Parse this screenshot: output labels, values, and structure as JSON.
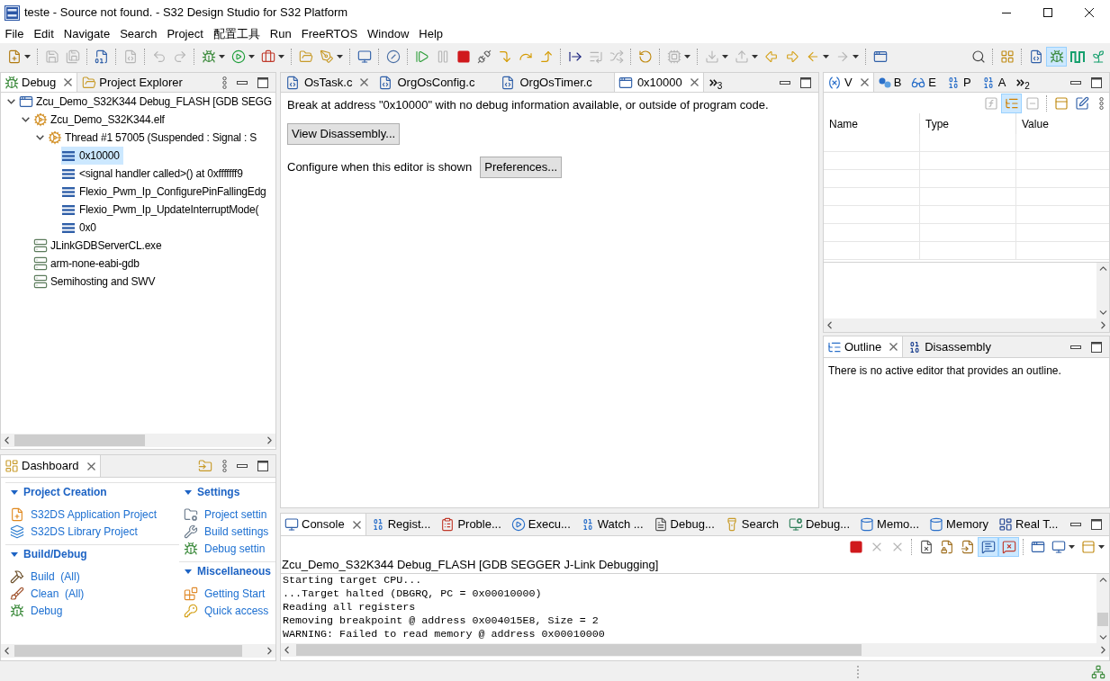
{
  "window": {
    "title": "teste - Source not found. - S32 Design Studio for S32 Platform"
  },
  "menu": [
    "File",
    "Edit",
    "Navigate",
    "Search",
    "Project",
    "配置工具",
    "Run",
    "FreeRTOS",
    "Window",
    "Help"
  ],
  "toolbar": [
    {
      "disabled": false
    },
    {
      "disabled": true
    },
    {
      "disabled": true
    },
    {
      "disabled": false
    },
    {
      "disabled": true
    },
    {
      "disabled": true
    },
    {
      "disabled": true
    },
    {
      "disabled": false
    },
    {
      "disabled": false
    },
    {
      "disabled": false
    },
    {
      "disabled": false
    },
    {
      "disabled": false
    },
    {
      "disabled": false
    },
    {
      "disabled": false
    },
    {
      "disabled": false
    },
    {
      "disabled": true
    },
    {
      "disabled": false
    },
    {
      "disabled": false
    },
    {
      "disabled": false
    },
    {
      "disabled": false
    },
    {
      "disabled": false
    },
    {
      "disabled": false
    },
    {
      "disabled": true
    },
    {
      "disabled": true
    },
    {
      "disabled": false
    },
    {
      "disabled": true
    },
    {
      "disabled": true
    },
    {
      "disabled": true
    },
    {
      "disabled": false
    },
    {
      "disabled": false
    },
    {
      "disabled": false
    },
    {
      "disabled": true
    },
    {
      "disabled": false
    },
    {
      "disabled": false
    },
    {
      "disabled": false
    }
  ],
  "perspectives": [
    {
      "selected": false
    },
    {
      "selected": true
    },
    {
      "selected": false
    },
    {
      "selected": false
    }
  ],
  "debug_view": {
    "tabs": [
      {
        "label": "Debug",
        "selected": true,
        "closable": true
      },
      {
        "label": "Project Explorer",
        "selected": false,
        "closable": false
      }
    ],
    "tree": [
      {
        "kind": "launch",
        "label": "Zcu_Demo_S32K344 Debug_FLASH [GDB SEGG",
        "expanded": true,
        "selected": false,
        "children": [
          {
            "kind": "target",
            "label": "Zcu_Demo_S32K344.elf",
            "expanded": true,
            "selected": false,
            "children": [
              {
                "kind": "thread",
                "label": "Thread #1 57005 (Suspended : Signal : S",
                "expanded": true,
                "selected": false,
                "children": [
                  {
                    "kind": "frame",
                    "label": "0x10000",
                    "selected": true
                  },
                  {
                    "kind": "frame",
                    "label": "<signal handler called>() at 0xfffffff9",
                    "selected": false
                  },
                  {
                    "kind": "frame",
                    "label": "Flexio_Pwm_Ip_ConfigurePinFallingEdg",
                    "selected": false
                  },
                  {
                    "kind": "frame",
                    "label": "Flexio_Pwm_Ip_UpdateInterruptMode(",
                    "selected": false
                  },
                  {
                    "kind": "frame",
                    "label": "0x0",
                    "selected": false
                  }
                ]
              }
            ]
          },
          {
            "kind": "process",
            "label": "JLinkGDBServerCL.exe",
            "selected": false
          },
          {
            "kind": "process",
            "label": "arm-none-eabi-gdb",
            "selected": false
          },
          {
            "kind": "process",
            "label": "Semihosting and SWV",
            "selected": false
          }
        ]
      }
    ]
  },
  "dashboard": {
    "tabs": [
      {
        "label": "Dashboard",
        "selected": true,
        "closable": true
      }
    ],
    "columns": [
      {
        "sections": [
          {
            "title": "Project Creation",
            "expanded": true,
            "items": [
              "S32DS Application Project",
              "S32DS Library Project"
            ]
          },
          {
            "title": "Build/Debug",
            "expanded": true,
            "items": [
              "Build  (All)",
              "Clean  (All)",
              "Debug"
            ]
          }
        ]
      },
      {
        "sections": [
          {
            "title": "Settings",
            "expanded": true,
            "items": [
              "Project settin",
              "Build settings",
              "Debug settin"
            ]
          },
          {
            "title": "Miscellaneous",
            "expanded": true,
            "items": [
              "Getting Start",
              "Quick access"
            ]
          }
        ]
      }
    ]
  },
  "editor": {
    "tabs": [
      {
        "label": "OsTask.c",
        "selected": false,
        "closable": true
      },
      {
        "label": "OrgOsConfig.c",
        "selected": false,
        "closable": false
      },
      {
        "label": "OrgOsTimer.c",
        "selected": false,
        "closable": false
      },
      {
        "label": "0x10000",
        "selected": true,
        "closable": true
      }
    ],
    "overflow_count": "3",
    "message": "Break at address \"0x10000\" with no debug information available, or outside of program code.",
    "view_button": "View Disassembly...",
    "configure_label": "Configure when this editor is shown",
    "preferences_button": "Preferences..."
  },
  "variables_view": {
    "tabs": [
      {
        "label": "V",
        "selected": true,
        "closable": true
      },
      {
        "label": "B",
        "selected": false,
        "closable": false
      },
      {
        "label": "E",
        "selected": false,
        "closable": false
      },
      {
        "label": "P",
        "selected": false,
        "closable": false
      },
      {
        "label": "A",
        "selected": false,
        "closable": false
      }
    ],
    "overflow_count": "2",
    "toolbar": [
      {
        "disabled": true,
        "selected": false
      },
      {
        "disabled": false,
        "selected": true
      },
      {
        "disabled": true,
        "selected": false
      },
      {
        "disabled": false,
        "selected": false
      },
      {
        "disabled": false,
        "selected": false
      }
    ],
    "columns": [
      "Name",
      "Type",
      "Value"
    ]
  },
  "outline_view": {
    "tabs": [
      {
        "label": "Outline",
        "selected": true,
        "closable": true
      },
      {
        "label": "Disassembly",
        "selected": false,
        "closable": false
      }
    ],
    "message": "There is no active editor that provides an outline."
  },
  "console_view": {
    "tabs": [
      {
        "label": "Console",
        "selected": true,
        "closable": true
      },
      {
        "label": "Regist...",
        "selected": false,
        "closable": false
      },
      {
        "label": "Proble...",
        "selected": false,
        "closable": false
      },
      {
        "label": "Execu...",
        "selected": false,
        "closable": false
      },
      {
        "label": "Watch ...",
        "selected": false,
        "closable": false
      },
      {
        "label": "Debug...",
        "selected": false,
        "closable": false
      },
      {
        "label": "Search",
        "selected": false,
        "closable": false
      },
      {
        "label": "Debug...",
        "selected": false,
        "closable": false
      },
      {
        "label": "Memo...",
        "selected": false,
        "closable": false
      },
      {
        "label": "Memory",
        "selected": false,
        "closable": false
      },
      {
        "label": "Real T...",
        "selected": false,
        "closable": false
      }
    ],
    "toolbar": [
      {
        "disabled": false,
        "selected": false
      },
      {
        "disabled": true,
        "selected": false
      },
      {
        "disabled": true,
        "selected": false
      },
      {
        "disabled": false,
        "selected": false
      },
      {
        "disabled": false,
        "selected": false
      },
      {
        "disabled": false,
        "selected": false
      },
      {
        "disabled": false,
        "selected": true
      },
      {
        "disabled": false,
        "selected": true
      },
      {
        "disabled": false,
        "selected": false
      },
      {
        "disabled": false,
        "selected": false
      },
      {
        "disabled": false,
        "selected": false
      }
    ],
    "title": "Zcu_Demo_S32K344 Debug_FLASH [GDB SEGGER J-Link Debugging]",
    "lines": [
      "Starting target CPU...",
      "...Target halted (DBGRQ, PC = 0x00010000)",
      "Reading all registers",
      "Removing breakpoint @ address 0x004015E8, Size = 2",
      "WARNING: Failed to read memory @ address 0x00010000"
    ]
  }
}
